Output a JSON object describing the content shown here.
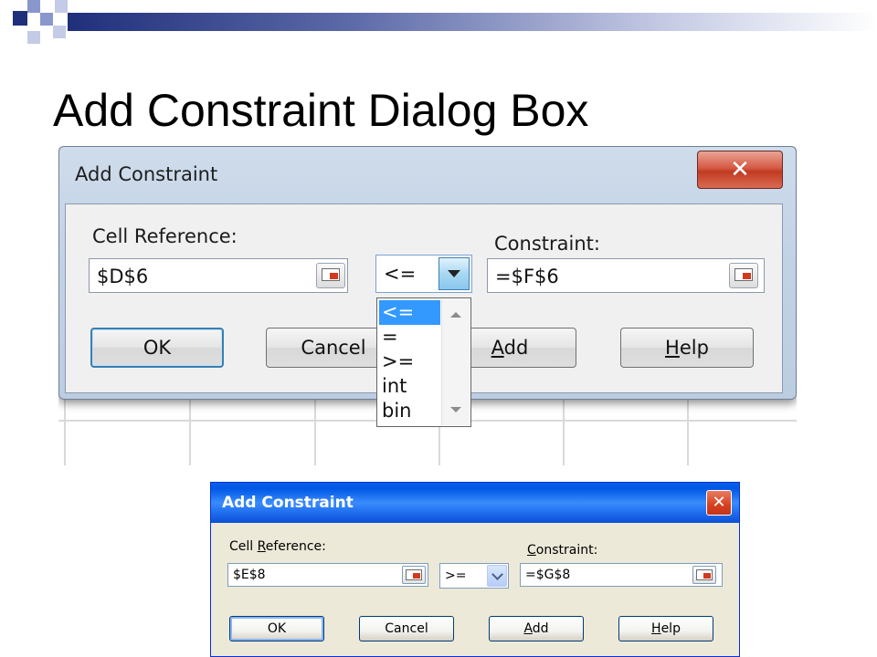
{
  "slide": {
    "title": "Add Constraint Dialog Box"
  },
  "dialog_win7": {
    "title": "Add Constraint",
    "close_glyph": "✕",
    "cell_reference_label": "Cell Reference:",
    "cell_reference_value": "$D$6",
    "operator_value": "<=",
    "operator_options": [
      "<=",
      "=",
      ">=",
      "int",
      "bin"
    ],
    "operator_selected_index": 0,
    "constraint_label": "Constraint:",
    "constraint_value": "=$F$6",
    "buttons": {
      "ok": "OK",
      "cancel": "Cancel",
      "add": "Add",
      "add_mnemonic": "A",
      "add_rest": "dd",
      "help": "Help",
      "help_mnemonic": "H",
      "help_rest": "elp"
    }
  },
  "dialog_xp": {
    "title": "Add Constraint",
    "close_glyph": "✕",
    "cell_reference_label_pre": "Cell ",
    "cell_reference_label_mnemonic": "R",
    "cell_reference_label_post": "eference:",
    "cell_reference_value": "$E$8",
    "operator_value": ">=",
    "constraint_label_mnemonic": "C",
    "constraint_label_post": "onstraint:",
    "constraint_value": "=$G$8",
    "buttons": {
      "ok": "OK",
      "cancel": "Cancel",
      "add_mnemonic": "A",
      "add_rest": "dd",
      "help_mnemonic": "H",
      "help_rest": "elp"
    }
  },
  "colors": {
    "slide_accent_dark": "#1f2f7a",
    "slide_accent_light": "#8a97cc",
    "win7_close": "#c23b22",
    "dropdown_selection": "#3399ff",
    "xp_titlebar": "#0058e6"
  }
}
